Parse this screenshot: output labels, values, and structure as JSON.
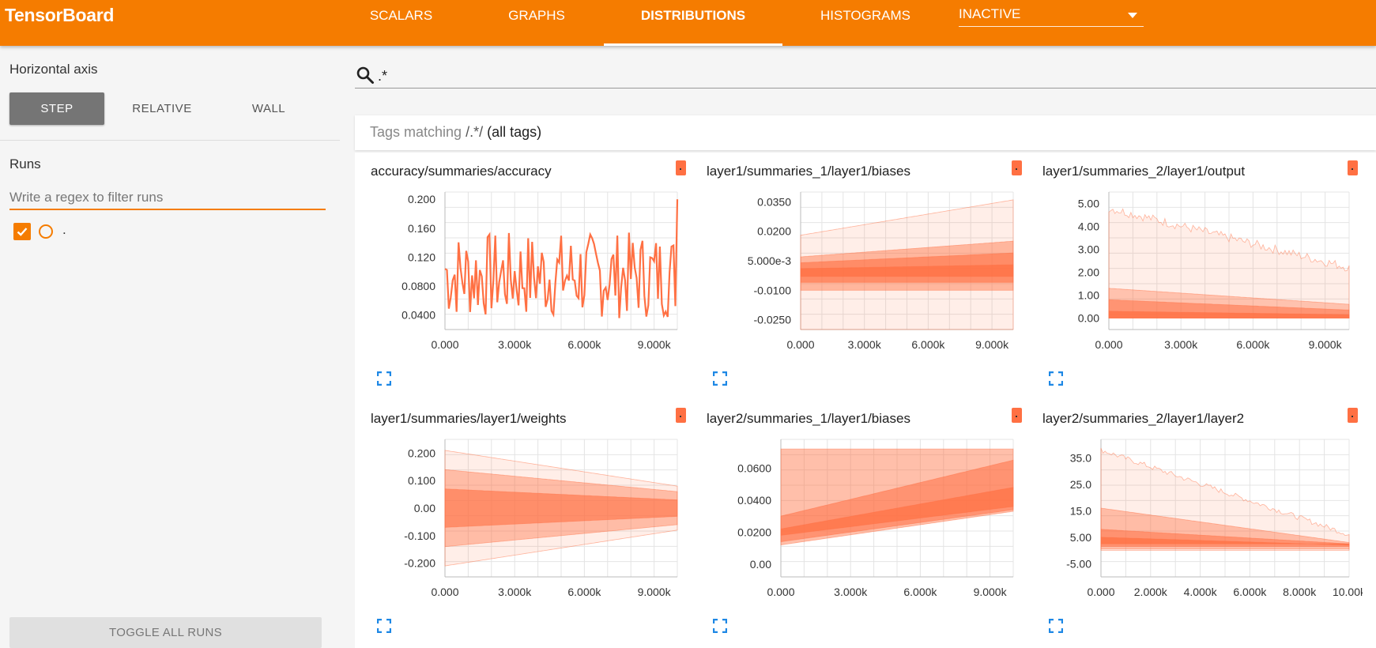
{
  "app": {
    "brand": "TensorBoard",
    "tabs": [
      {
        "label": "SCALARS",
        "active": false
      },
      {
        "label": "GRAPHS",
        "active": false
      },
      {
        "label": "DISTRIBUTIONS",
        "active": true
      },
      {
        "label": "HISTOGRAMS",
        "active": false
      }
    ],
    "inactive_select": "INACTIVE"
  },
  "sidebar": {
    "horizontal_axis_label": "Horizontal axis",
    "axis_options": [
      {
        "label": "STEP",
        "selected": true
      },
      {
        "label": "RELATIVE",
        "selected": false
      },
      {
        "label": "WALL",
        "selected": false
      }
    ],
    "runs_label": "Runs",
    "regex_placeholder": "Write a regex to filter runs",
    "runs": [
      {
        "name": ".",
        "checked": true
      }
    ],
    "toggle_all_label": "TOGGLE ALL RUNS"
  },
  "search": {
    "value": ".*"
  },
  "tags_header": {
    "prefix": "Tags matching ",
    "pattern": "/.*/",
    "suffix": " (all tags)"
  },
  "colors": {
    "accent": "#f57c00",
    "series": "#ff7043",
    "expand_icon": "#1e88e5"
  },
  "icons": {
    "search": "search-icon",
    "expand": "fullscreen-icon",
    "checkbox": "check-icon"
  },
  "charts": [
    {
      "title": "accuracy/summaries/accuracy",
      "type": "line",
      "x_ticks": [
        "0.000",
        "3.000k",
        "6.000k",
        "9.000k"
      ],
      "y_ticks": [
        "0.200",
        "0.160",
        "0.120",
        "0.0800",
        "0.0400"
      ],
      "x_range": [
        0,
        10000
      ],
      "y_range": [
        0.02,
        0.21
      ]
    },
    {
      "title": "layer1/summaries_1/layer1/biases",
      "type": "distribution",
      "x_ticks": [
        "0.000",
        "3.000k",
        "6.000k",
        "9.000k"
      ],
      "y_ticks": [
        "0.0350",
        "0.0200",
        "5.000e-3",
        "-0.0100",
        "-0.0250"
      ],
      "x_range": [
        0,
        10000
      ],
      "y_range": [
        -0.03,
        0.04
      ]
    },
    {
      "title": "layer1/summaries_2/layer1/output",
      "type": "distribution",
      "x_ticks": [
        "0.000",
        "3.000k",
        "6.000k",
        "9.000k"
      ],
      "y_ticks": [
        "5.00",
        "4.00",
        "3.00",
        "2.00",
        "1.00",
        "0.00"
      ],
      "x_range": [
        0,
        10000
      ],
      "y_range": [
        -0.5,
        5.5
      ]
    },
    {
      "title": "layer1/summaries/layer1/weights",
      "type": "distribution",
      "x_ticks": [
        "0.000",
        "3.000k",
        "6.000k",
        "9.000k"
      ],
      "y_ticks": [
        "0.200",
        "0.100",
        "0.00",
        "-0.100",
        "-0.200"
      ],
      "x_range": [
        0,
        10000
      ],
      "y_range": [
        -0.25,
        0.25
      ]
    },
    {
      "title": "layer2/summaries_1/layer1/biases",
      "type": "distribution",
      "x_ticks": [
        "0.000",
        "3.000k",
        "6.000k",
        "9.000k"
      ],
      "y_ticks": [
        "0.0600",
        "0.0400",
        "0.0200",
        "0.00"
      ],
      "x_range": [
        0,
        10000
      ],
      "y_range": [
        -0.008,
        0.078
      ]
    },
    {
      "title": "layer2/summaries_2/layer1/layer2",
      "type": "distribution",
      "x_ticks": [
        "0.000",
        "2.000k",
        "4.000k",
        "6.000k",
        "8.000k",
        "10.00k"
      ],
      "y_ticks": [
        "35.0",
        "25.0",
        "15.0",
        "5.00",
        "-5.00"
      ],
      "x_range": [
        0,
        10000
      ],
      "y_range": [
        -10,
        42
      ]
    }
  ]
}
